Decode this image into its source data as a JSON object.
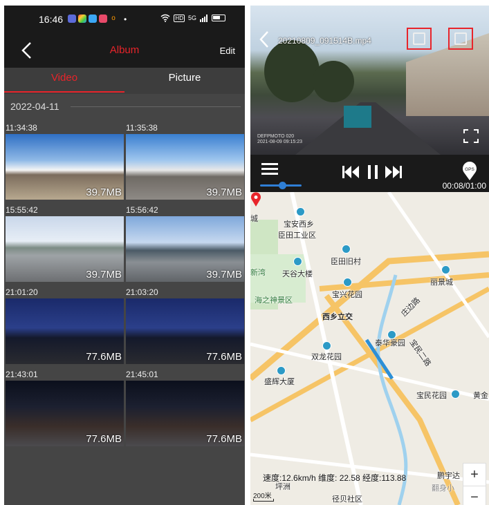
{
  "left": {
    "status": {
      "time": "16:46",
      "dot": "•",
      "network": "HD",
      "signal": "5G"
    },
    "appbar": {
      "title": "Album",
      "edit": "Edit"
    },
    "tabs": {
      "video": "Video",
      "picture": "Picture"
    },
    "date": "2022-04-11",
    "items": [
      {
        "time": "11:34:38",
        "size": "39.7MB"
      },
      {
        "time": "11:35:38",
        "size": "39.7MB"
      },
      {
        "time": "15:55:42",
        "size": "39.7MB"
      },
      {
        "time": "15:56:42",
        "size": "39.7MB"
      },
      {
        "time": "21:01:20",
        "size": "77.6MB"
      },
      {
        "time": "21:03:20",
        "size": "77.6MB"
      },
      {
        "time": "21:43:01",
        "size": "77.6MB"
      },
      {
        "time": "21:45:01",
        "size": "77.6MB"
      }
    ]
  },
  "right": {
    "video": {
      "filename": "20210809_091514B.mp4",
      "watermark_line1": "DEFPMOTO 020",
      "watermark_line2": "2021-08-09 09:15:23",
      "current_time": "00:08",
      "duration": "01:00",
      "time_display": "00:08/01:00",
      "gps_label": "GPS"
    },
    "map": {
      "labels": [
        {
          "text": "宝安西乡"
        },
        {
          "text": "臣田工业区"
        },
        {
          "text": "臣田旧村"
        },
        {
          "text": "天谷大楼"
        },
        {
          "text": "宝兴花园"
        },
        {
          "text": "丽景城"
        },
        {
          "text": "海之神景区"
        },
        {
          "text": "西乡立交"
        },
        {
          "text": "庄边路"
        },
        {
          "text": "泰华豪园"
        },
        {
          "text": "宝民二路"
        },
        {
          "text": "双龙花园"
        },
        {
          "text": "盛辉大厦"
        },
        {
          "text": "宝民花园"
        },
        {
          "text": "黄金"
        },
        {
          "text": "城"
        },
        {
          "text": "新湾"
        },
        {
          "text": "鹏宇达"
        },
        {
          "text": "翻身小"
        },
        {
          "text": "径贝社区"
        },
        {
          "text": "坪洲"
        }
      ],
      "info": "速度:12.6km/h 维度: 22.58 经度:113.88",
      "zoom_in": "+",
      "zoom_out": "−",
      "scale": "200米"
    }
  }
}
